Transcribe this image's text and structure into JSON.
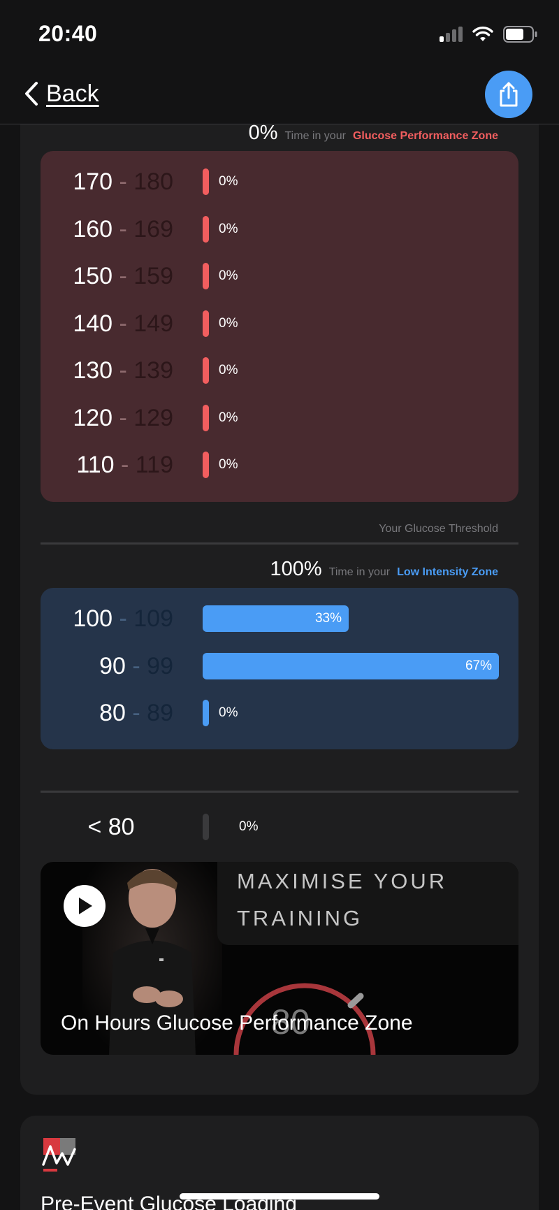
{
  "status_bar": {
    "time": "20:40"
  },
  "nav": {
    "back_label": "Back"
  },
  "performance_zone": {
    "percent": "0%",
    "prefix": "Time in your",
    "name": "Glucose Performance Zone",
    "accent_color": "#f25e5f",
    "rows": [
      {
        "low": "170",
        "high": "180",
        "pct_label": "0%",
        "fraction": 0
      },
      {
        "low": "160",
        "high": "169",
        "pct_label": "0%",
        "fraction": 0
      },
      {
        "low": "150",
        "high": "159",
        "pct_label": "0%",
        "fraction": 0
      },
      {
        "low": "140",
        "high": "149",
        "pct_label": "0%",
        "fraction": 0
      },
      {
        "low": "130",
        "high": "139",
        "pct_label": "0%",
        "fraction": 0
      },
      {
        "low": "120",
        "high": "129",
        "pct_label": "0%",
        "fraction": 0
      },
      {
        "low": "110",
        "high": "119",
        "pct_label": "0%",
        "fraction": 0
      }
    ]
  },
  "threshold_label": "Your Glucose Threshold",
  "low_zone": {
    "percent": "100%",
    "prefix": "Time in your",
    "name": "Low Intensity Zone",
    "accent_color": "#4a9cf5",
    "rows": [
      {
        "low": "100",
        "high": "109",
        "pct_label": "33%",
        "fraction": 0.33
      },
      {
        "low": "90",
        "high": "99",
        "pct_label": "67%",
        "fraction": 0.67
      },
      {
        "low": "80",
        "high": "89",
        "pct_label": "0%",
        "fraction": 0
      }
    ]
  },
  "below_zone": {
    "label": "< 80",
    "pct_label": "0%",
    "fraction": 0
  },
  "video": {
    "banner_line1": "MAXIMISE YOUR",
    "banner_line2": "TRAINING",
    "gauge_value": "80",
    "title": "On Hours Glucose Performance Zone"
  },
  "next_card": {
    "title": "Pre-Event Glucose Loading"
  }
}
